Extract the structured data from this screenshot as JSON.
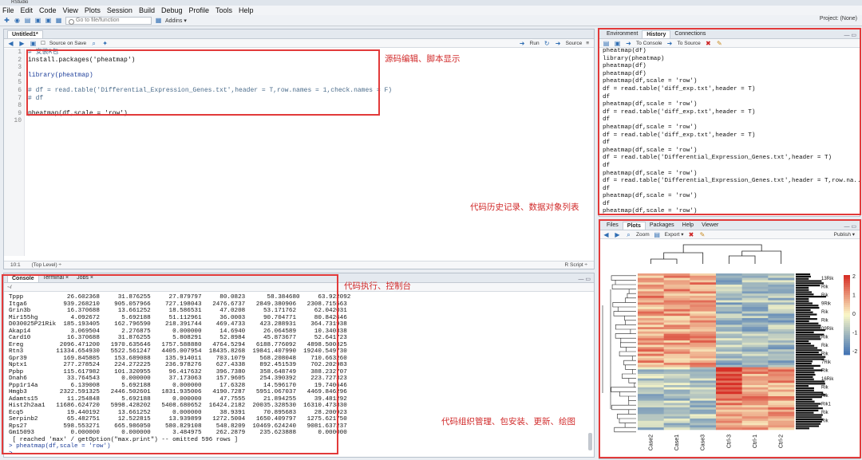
{
  "window": {
    "title": "RStudio"
  },
  "menu": [
    "File",
    "Edit",
    "Code",
    "View",
    "Plots",
    "Session",
    "Build",
    "Debug",
    "Profile",
    "Tools",
    "Help"
  ],
  "toolbar": {
    "goto_placeholder": "Go to file/function",
    "addins": "Addins ▾",
    "project": "Project: (None)"
  },
  "editor": {
    "tab": "Untitled1*",
    "source_on_save": "Source on Save",
    "run": "Run",
    "source": "Source",
    "lines": [
      {
        "n": "1",
        "t": "# 安装R包",
        "c": "cm"
      },
      {
        "n": "2",
        "t": "install.packages('pheatmap')",
        "c": ""
      },
      {
        "n": "3",
        "t": "",
        "c": ""
      },
      {
        "n": "4",
        "t": "library(pheatmap)",
        "c": "kw"
      },
      {
        "n": "5",
        "t": "",
        "c": ""
      },
      {
        "n": "6",
        "t": "# df = read.table('Differential_Expression_Genes.txt',header = T,row.names = 1,check.names = F)",
        "c": "cm"
      },
      {
        "n": "7",
        "t": "# df",
        "c": "cm"
      },
      {
        "n": "8",
        "t": "",
        "c": ""
      },
      {
        "n": "9",
        "t": "pheatmap(df,scale = 'row')",
        "c": ""
      },
      {
        "n": "10",
        "t": "",
        "c": ""
      }
    ],
    "status_pos": "10:1",
    "status_scope": "(Top Level) ÷",
    "status_type": "R Script ÷"
  },
  "console": {
    "tabs": [
      "Console",
      "Terminal ×",
      "Jobs ×"
    ],
    "path": "~/",
    "lines": [
      "Tppp            26.602368     31.876255     27.879797     80.0823      58.384680     63.922092",
      "Itga6          939.268210    905.057966    727.198043   2476.6737   2849.380906   2308.715563",
      "Grin3b          16.370688     13.661252     18.586531     47.0208     53.171762     62.042031",
      "Mir155hg         4.092672      5.692188     51.112961     36.0003     90.704771     80.842646",
      "D030025P21Rik  185.193405    162.796590    218.391744    469.4733    423.288931    364.731938",
      "Akap14           3.069504      2.276875      0.000000     14.6940     26.064589     10.340338",
      "Card10          16.370688     31.876255      5.808291     52.8984     45.873677     52.641723",
      "Ereg          2096.471200   1970.635646   1757.588880   4764.5294   6188.776092   4898.500325",
      "Rtn3         11334.654930   5522.561247   4405.007954  18435.8268  19841.407990  19240.549730",
      "Gpr39          169.845885    153.689088    135.914011    703.1079    568.208048    710.663260",
      "Nptx1          277.278524    224.272225    236.978276    627.4338    892.451539    702.202983",
      "Ppbp           115.617982    101.320955     96.417632    396.7380    358.648749    388.232707",
      "Dnah6           33.764543      0.000000     37.173063    157.9605    254.390392    223.727323",
      "Ppp1r14a         6.139008      5.692188      0.000000     17.6328     14.596170     19.740646",
      "Hmgb3         2322.591325   2446.502601   1831.935006   4190.7287   5951.067037   4469.846296",
      "Adamts15        11.254848      5.692188      0.000000     47.7555     21.894255     39.481292",
      "Hist2h2aa1   11686.624720   5998.428202   5408.680652  16424.2182  20035.328530  16310.473830",
      "Ecq5            19.440192     13.661252      0.000000     38.9391     70.895683     28.200923",
      "Serpinb2        65.482751     12.522815     13.939899   1272.5004   1650.409797   1275.621750",
      "Rps27          598.553271    665.986050    580.829108    548.8209  10469.624240   9081.637237",
      "Gm15093          0.000000      0.000000      3.484975    262.2879    235.623888      0.000000",
      " [ reached 'max' / getOption(\"max.print\") -- omitted 596 rows ]",
      "> pheatmap(df,scale = 'row')",
      ">"
    ]
  },
  "history": {
    "tabs": [
      "Environment",
      "History",
      "Connections"
    ],
    "to_console": "To Console",
    "to_source": "To Source",
    "lines": [
      "pheatmap(df)",
      "library(pheatmap)",
      "pheatmap(df)",
      "pheatmap(df)",
      "pheatmap(df,scale = 'row')",
      "df = read.table('diff_exp.txt',header = T)",
      "df",
      "pheatmap(df,scale = 'row')",
      "df = read.table('diff_exp.txt',header = T)",
      "df",
      "pheatmap(df,scale = 'row')",
      "df = read.table('diff_exp.txt',header = T)",
      "df",
      "pheatmap(df,scale = 'row')",
      "df = read.table('Differential_Expression_Genes.txt',header = T)",
      "df",
      "pheatmap(df,scale = 'row')",
      "df = read.table('Differential_Expression_Genes.txt',header = T,row.na...",
      "df",
      "pheatmap(df,scale = 'row')",
      "df",
      "pheatmap(df,scale = 'row')"
    ]
  },
  "files": {
    "tabs": [
      "Files",
      "Plots",
      "Packages",
      "Help",
      "Viewer"
    ],
    "zoom": "Zoom",
    "export": "Export ▾",
    "publish": "Publish ▾"
  },
  "heatmap": {
    "columns": [
      "Case2",
      "Case1",
      "Case3",
      "Ctrl-3",
      "Ctrl-1",
      "Ctrl-2"
    ],
    "legend_ticks": [
      "2",
      "1",
      "0",
      "-1",
      "-2"
    ],
    "row_labels": [
      "13Rik",
      "Rik",
      "Rik",
      "9Rik",
      "Rik",
      "Rik",
      "09Rik",
      "Rik",
      "Rik",
      "Rik",
      "7Rik",
      "Rik",
      "16Rik",
      "Rik",
      "Rik",
      "Rik1",
      "Rik",
      "Rik"
    ]
  },
  "annotations": {
    "editor": "源码编辑、脚本显示",
    "console": "代码执行、控制台",
    "history": "代码历史记录、数据对象列表",
    "files": "代码组织管理、包安装、更新、绘图"
  },
  "colors": {
    "annotation": "#e23a3a",
    "heat_high": "#d73027",
    "heat_mid": "#fbf8c8",
    "heat_low": "#4575b4"
  }
}
